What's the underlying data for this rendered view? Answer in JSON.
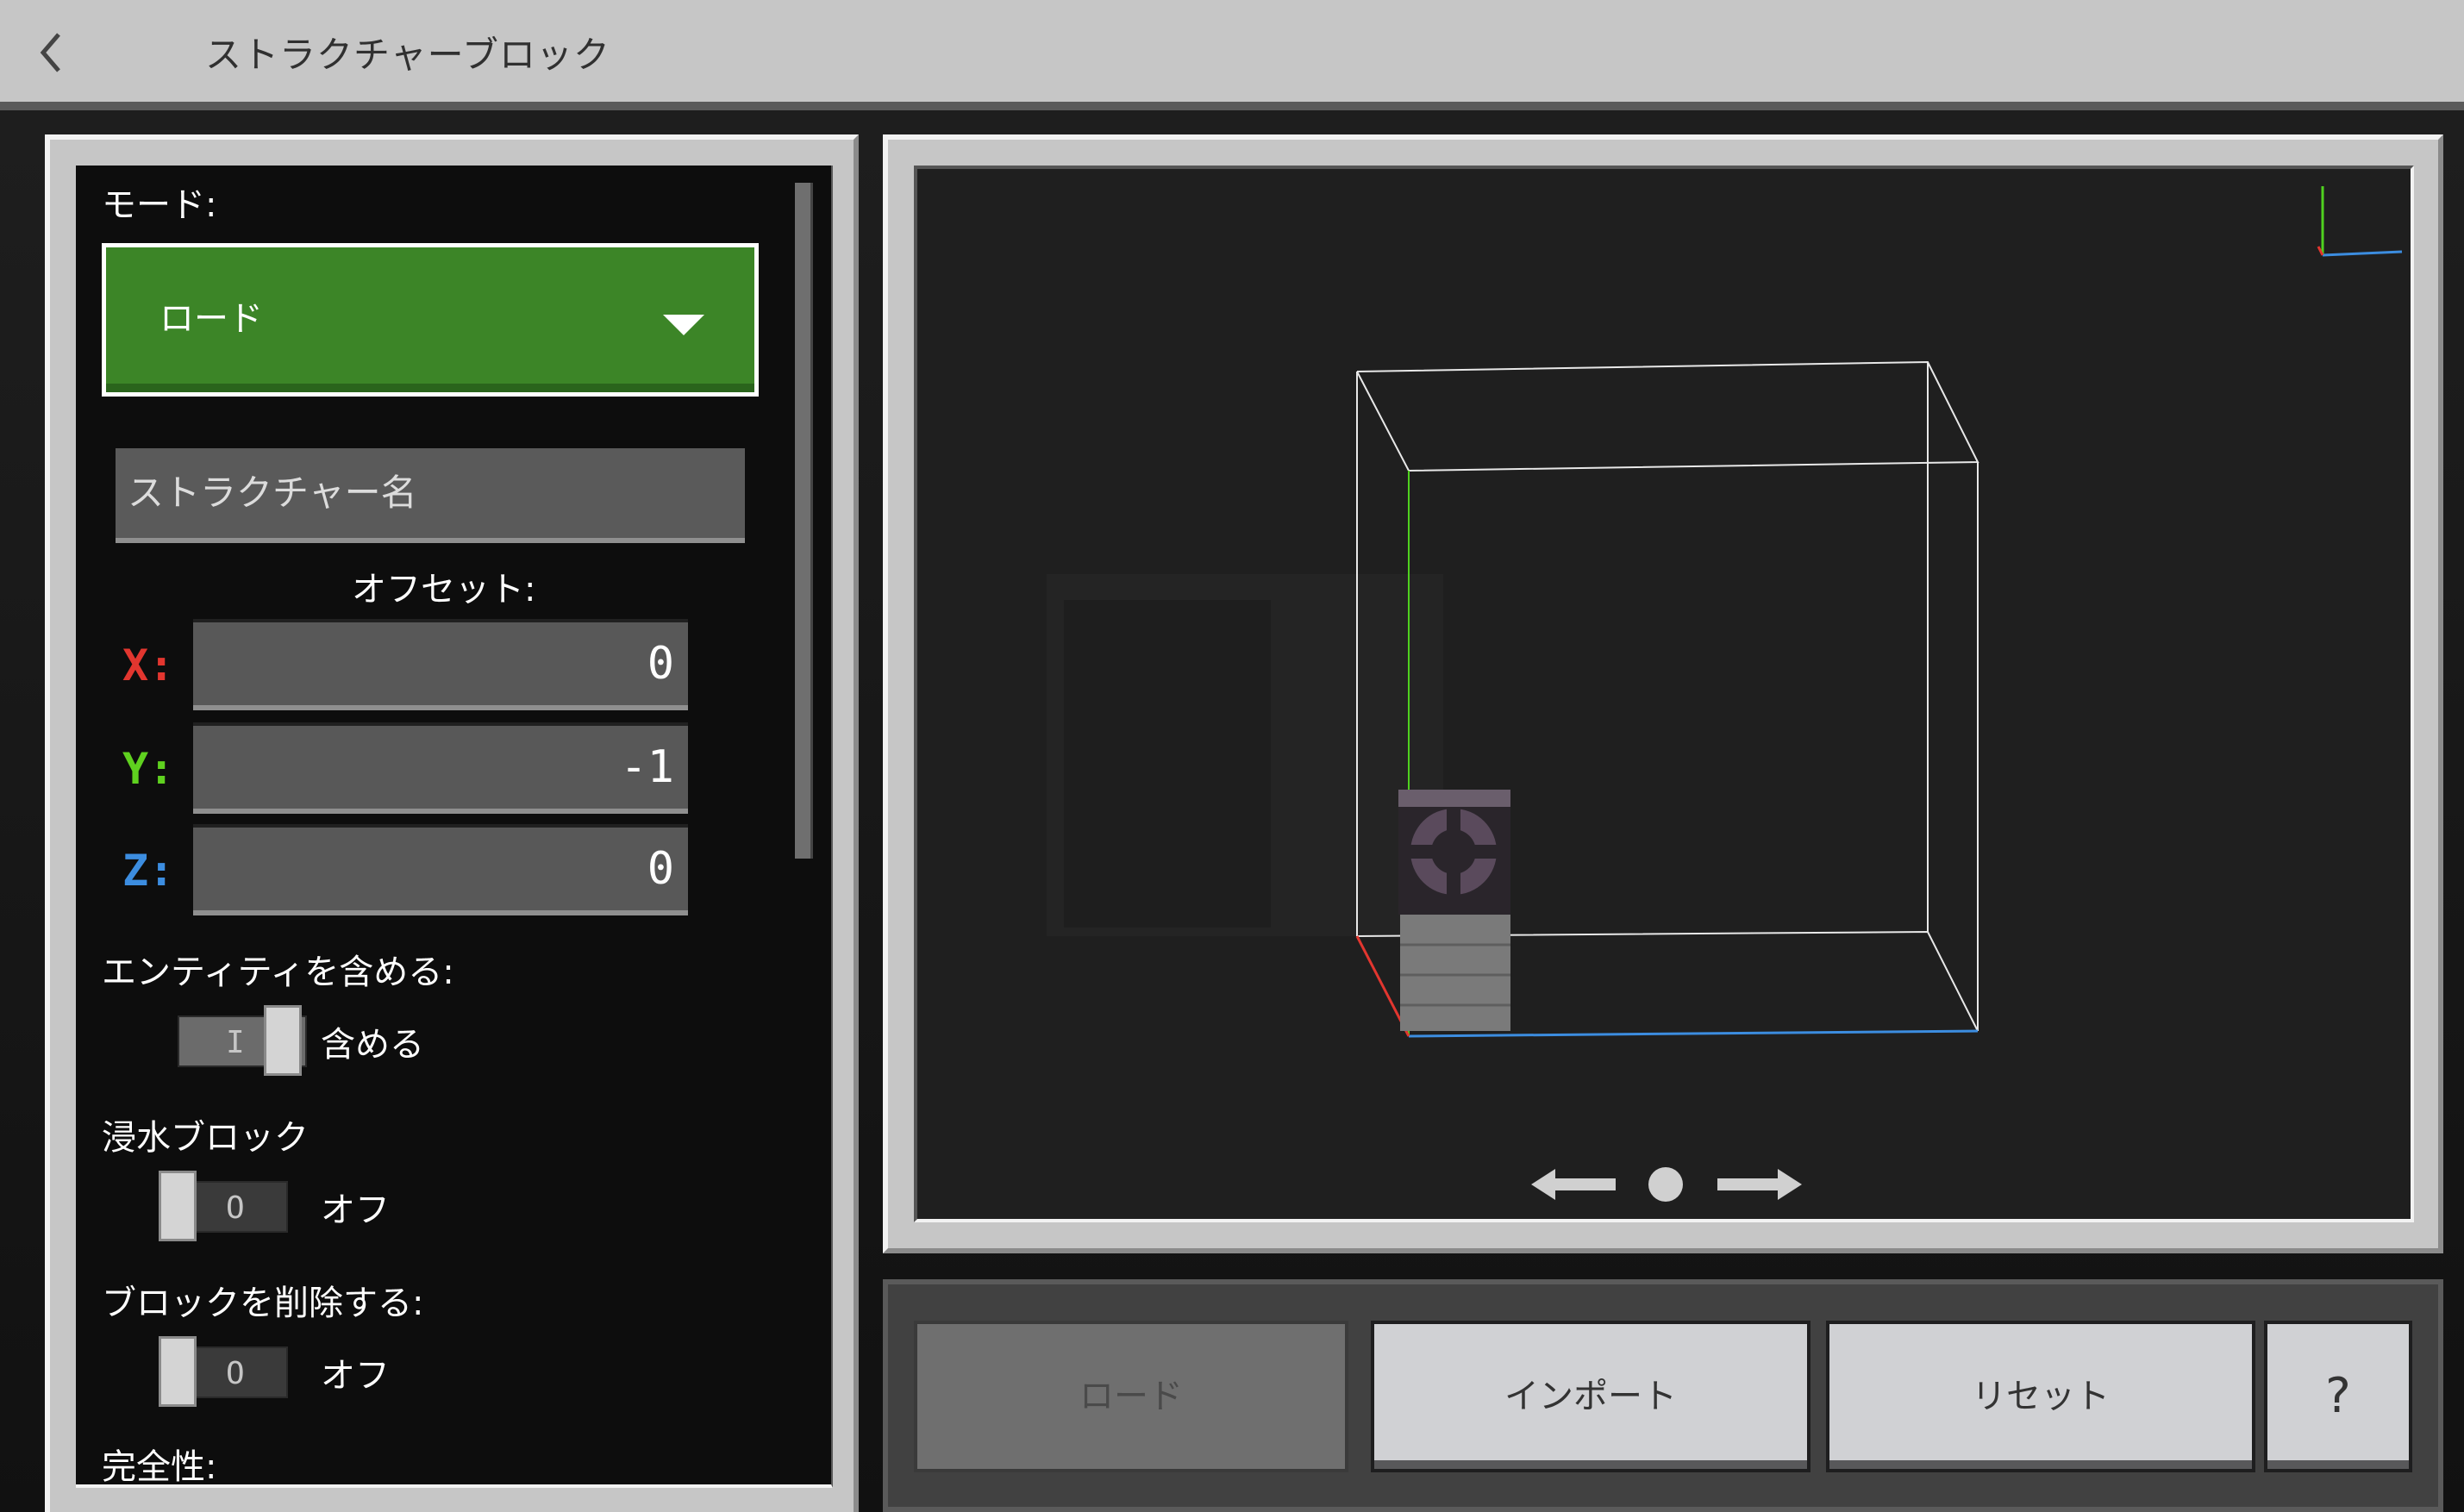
{
  "header": {
    "title": "ストラクチャーブロック"
  },
  "left": {
    "mode_label": "モード:",
    "mode_value": "ロード",
    "structure_name_placeholder": "ストラクチャー名",
    "offset_label": "オフセット:",
    "offset": [
      {
        "axis": "X:",
        "value": "0",
        "color": "#e2362f"
      },
      {
        "axis": "Y:",
        "value": "-1",
        "color": "#5fd11f"
      },
      {
        "axis": "Z:",
        "value": "0",
        "color": "#3c8de0"
      }
    ],
    "include_entities_label": "エンティティを含める:",
    "include_entities_state": "含める",
    "include_entities_on": true,
    "waterlogged_label": "浸水ブロック",
    "waterlogged_state": "オフ",
    "waterlogged_on": false,
    "remove_blocks_label": "ブロックを削除する:",
    "remove_blocks_state": "オフ",
    "remove_blocks_on": false,
    "integrity_label": "完全性:"
  },
  "buttons": {
    "load": "ロード",
    "import": "インポート",
    "reset": "リセット",
    "help": "?"
  },
  "colors": {
    "accent_green": "#3c8527",
    "axis_x": "#e2362f",
    "axis_y": "#5fd11f",
    "axis_z": "#3c8de0"
  }
}
